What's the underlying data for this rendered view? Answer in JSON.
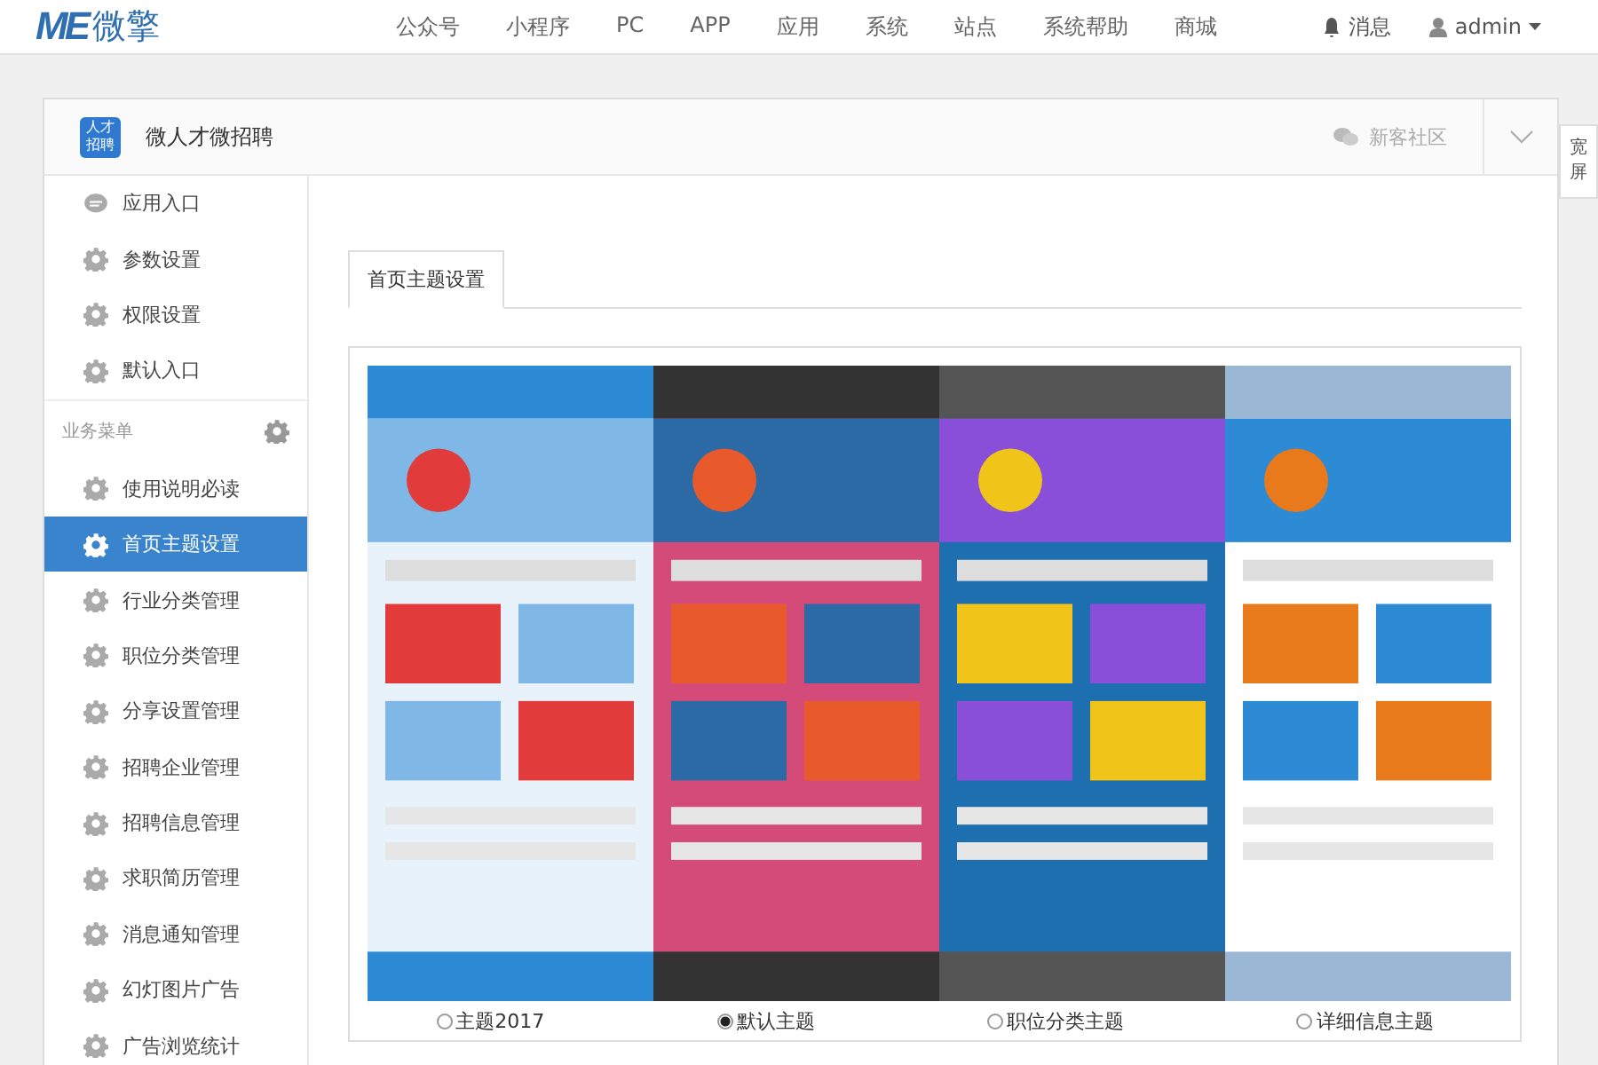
{
  "topbar": {
    "logo_mark": "ME",
    "logo_text": "微擎",
    "nav": [
      "公众号",
      "小程序",
      "PC",
      "APP",
      "应用",
      "系统",
      "站点",
      "系统帮助",
      "商城"
    ],
    "messages": "消息",
    "user": "admin"
  },
  "panel": {
    "app_icon_text": "人才招聘",
    "app_title": "微人才微招聘",
    "community": "新客社区",
    "wide_button": "宽屏"
  },
  "sidebar": {
    "top_items": [
      {
        "label": "应用入口",
        "kind": "chat",
        "selected": false
      },
      {
        "label": "参数设置",
        "kind": "gear",
        "selected": false
      },
      {
        "label": "权限设置",
        "kind": "gear",
        "selected": false
      },
      {
        "label": "默认入口",
        "kind": "gear",
        "selected": false
      }
    ],
    "section_title": "业务菜单",
    "items": [
      {
        "label": "使用说明必读",
        "kind": "gear",
        "selected": false
      },
      {
        "label": "首页主题设置",
        "kind": "gear",
        "selected": true
      },
      {
        "label": "行业分类管理",
        "kind": "gear",
        "selected": false
      },
      {
        "label": "职位分类管理",
        "kind": "gear",
        "selected": false
      },
      {
        "label": "分享设置管理",
        "kind": "gear",
        "selected": false
      },
      {
        "label": "招聘企业管理",
        "kind": "gear",
        "selected": false
      },
      {
        "label": "招聘信息管理",
        "kind": "gear",
        "selected": false
      },
      {
        "label": "求职简历管理",
        "kind": "gear",
        "selected": false
      },
      {
        "label": "消息通知管理",
        "kind": "gear",
        "selected": false
      },
      {
        "label": "幻灯图片广告",
        "kind": "gear",
        "selected": false
      },
      {
        "label": "广告浏览统计",
        "kind": "gear",
        "selected": false
      }
    ]
  },
  "content": {
    "tab": "首页主题设置",
    "themes": [
      {
        "label": "主题2017",
        "selected": false,
        "kind": "picture"
      },
      {
        "label": "默认主题",
        "selected": true,
        "kind": "picture"
      },
      {
        "label": "职位分类主题",
        "selected": false,
        "kind": "picture"
      },
      {
        "label": "详细信息主题",
        "selected": false,
        "kind": "picture"
      }
    ]
  }
}
